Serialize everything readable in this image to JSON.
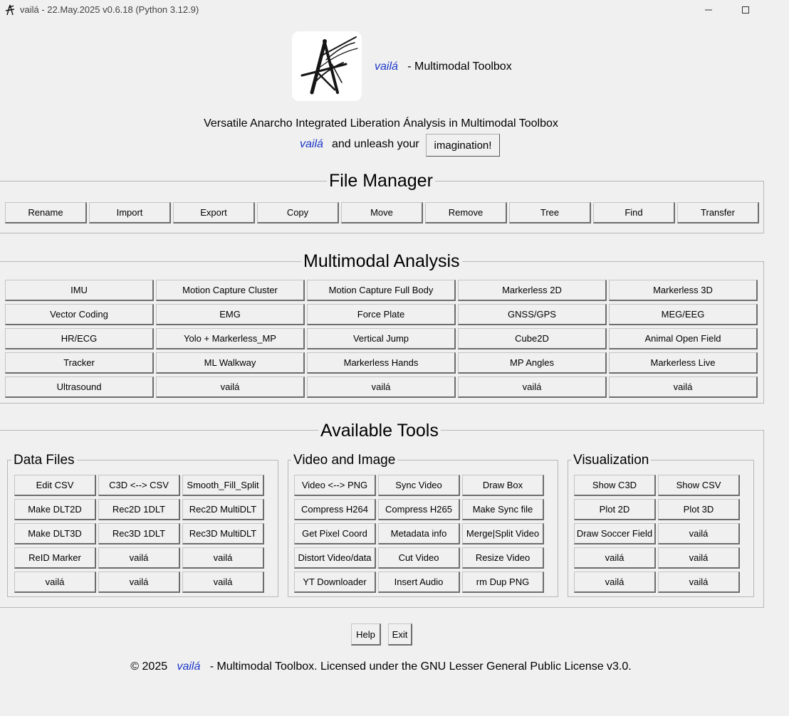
{
  "window": {
    "title": "vailá - 22.May.2025 v0.6.18 (Python 3.12.9)",
    "icon": "vaila-logo-icon",
    "controls": [
      "minimize",
      "maximize"
    ]
  },
  "header": {
    "brand": "vailá",
    "title_suffix": "- Multimodal Toolbox",
    "subtitle": "Versatile Anarcho Integrated Liberation Ánalysis in Multimodal Toolbox",
    "tagline_brand": "vailá",
    "tagline_text": "and unleash your",
    "imagination_button": "imagination!"
  },
  "file_manager": {
    "title": "File Manager",
    "buttons": [
      "Rename",
      "Import",
      "Export",
      "Copy",
      "Move",
      "Remove",
      "Tree",
      "Find",
      "Transfer"
    ]
  },
  "multimodal": {
    "title": "Multimodal Analysis",
    "rows": [
      [
        "IMU",
        "Motion Capture Cluster",
        "Motion Capture Full Body",
        "Markerless 2D",
        "Markerless 3D"
      ],
      [
        "Vector Coding",
        "EMG",
        "Force Plate",
        "GNSS/GPS",
        "MEG/EEG"
      ],
      [
        "HR/ECG",
        "Yolo + Markerless_MP",
        "Vertical Jump",
        "Cube2D",
        "Animal Open Field"
      ],
      [
        "Tracker",
        "ML Walkway",
        "Markerless Hands",
        "MP Angles",
        "Markerless Live"
      ],
      [
        "Ultrasound",
        "vailá",
        "vailá",
        "vailá",
        "vailá"
      ]
    ]
  },
  "tools": {
    "title": "Available Tools",
    "data_files": {
      "title": "Data Files",
      "rows": [
        [
          "Edit CSV",
          "C3D <--> CSV",
          "Smooth_Fill_Split"
        ],
        [
          "Make DLT2D",
          "Rec2D 1DLT",
          "Rec2D MultiDLT"
        ],
        [
          "Make DLT3D",
          "Rec3D 1DLT",
          "Rec3D MultiDLT"
        ],
        [
          "ReID Marker",
          "vailá",
          "vailá"
        ],
        [
          "vailá",
          "vailá",
          "vailá"
        ]
      ]
    },
    "video_image": {
      "title": "Video and Image",
      "rows": [
        [
          "Video <--> PNG",
          "Sync Video",
          "Draw Box"
        ],
        [
          "Compress H264",
          "Compress H265",
          "Make Sync file"
        ],
        [
          "Get Pixel Coord",
          "Metadata info",
          "Merge|Split Video"
        ],
        [
          "Distort Video/data",
          "Cut Video",
          "Resize Video"
        ],
        [
          "YT Downloader",
          "Insert Audio",
          "rm Dup PNG"
        ]
      ]
    },
    "visualization": {
      "title": "Visualization",
      "rows": [
        [
          "Show C3D",
          "Show CSV"
        ],
        [
          "Plot 2D",
          "Plot 3D"
        ],
        [
          "Draw Soccer Field",
          "vailá"
        ],
        [
          "vailá",
          "vailá"
        ],
        [
          "vailá",
          "vailá"
        ]
      ]
    }
  },
  "bottom": {
    "help": "Help",
    "exit": "Exit"
  },
  "footer": {
    "prefix": "© 2025",
    "brand": "vailá",
    "text": "- Multimodal Toolbox. Licensed under the GNU Lesser General Public License v3.0."
  },
  "colors": {
    "brand_blue": "#1a35c8",
    "background": "#f0f0f0",
    "button_face": "#f0f0f0"
  }
}
